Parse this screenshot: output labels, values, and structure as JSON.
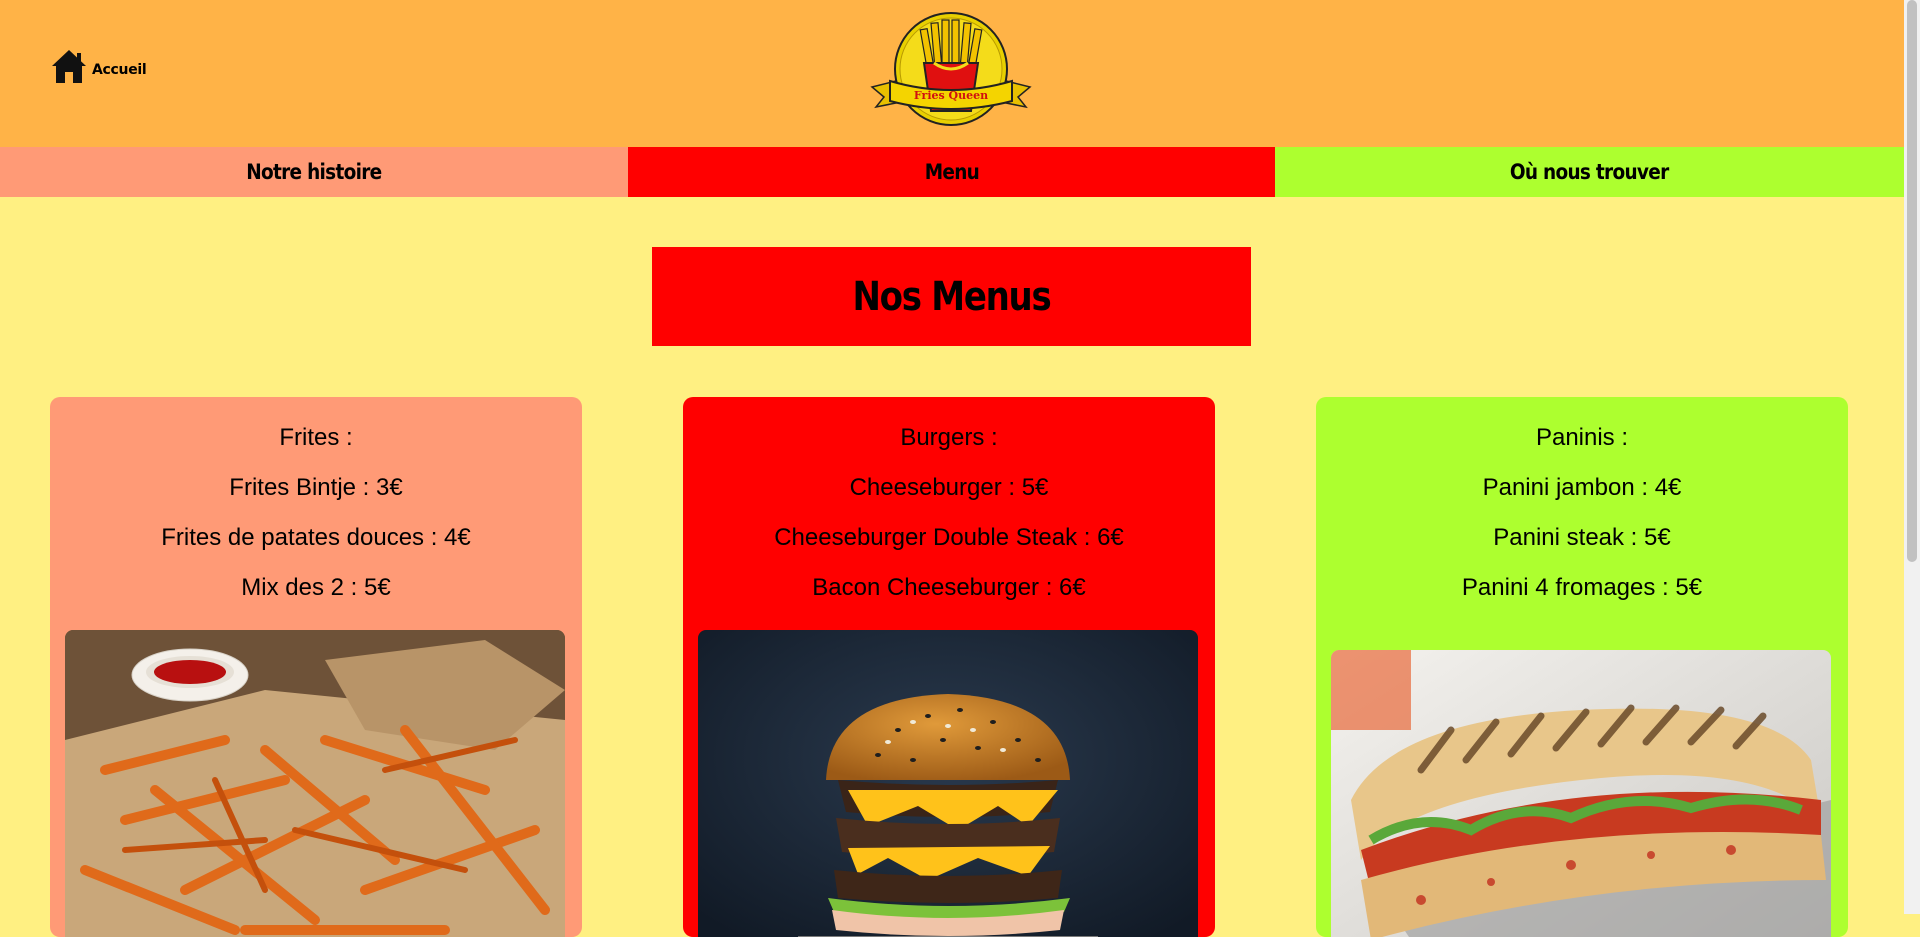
{
  "header": {
    "home_label": "Accueil",
    "logo_text": "Fries Queen"
  },
  "nav": {
    "items": [
      {
        "label": "Notre histoire",
        "color": "#ff9a76"
      },
      {
        "label": "Menu",
        "color": "#ff0000"
      },
      {
        "label": "Où nous trouver",
        "color": "#adff2f"
      }
    ]
  },
  "main": {
    "title": "Nos Menus",
    "cards": [
      {
        "heading": "Frites :",
        "items": [
          "Frites Bintje : 3€",
          "Frites de patates douces : 4€",
          "Mix des 2 : 5€"
        ],
        "image": "sweet-potato-fries-photo",
        "color": "#ff9a76"
      },
      {
        "heading": "Burgers :",
        "items": [
          "Cheeseburger : 5€",
          "Cheeseburger Double Steak : 6€",
          "Bacon Cheeseburger : 6€"
        ],
        "image": "double-cheeseburger-photo",
        "color": "#ff0000"
      },
      {
        "heading": "Paninis :",
        "items": [
          "Panini jambon : 4€",
          "Panini steak : 5€",
          "Panini 4 fromages : 5€"
        ],
        "image": "panini-photo",
        "color": "#adff2f"
      }
    ]
  },
  "colors": {
    "page_background": "#fff082",
    "header_background": "#ffb347"
  }
}
